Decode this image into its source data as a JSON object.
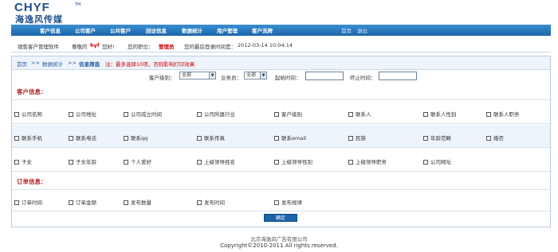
{
  "logo": {
    "en": "CHYF",
    "tm": "TM",
    "cn": "海逸风传媒"
  },
  "nav": {
    "items": [
      "客户信息",
      "公司客户",
      "公共客户",
      "回访信息",
      "数据统计",
      "用户管理",
      "客户洗牌"
    ],
    "right": [
      "首页",
      "退出"
    ]
  },
  "info": {
    "system": "销售客户管理软件",
    "greet_pre": "尊敬的",
    "user": "hyf",
    "greet_post": "您好!",
    "role_label": "您的职位：",
    "role": "管理员",
    "last_login_label": "您的最后登录时间是：",
    "last_login": "2012-03-14 10:04:14"
  },
  "crumb": {
    "home": "首页",
    "sep1": ">>",
    "stats": "数据统计",
    "sep2": ">>",
    "current": "信息筛选",
    "note": "注：最多选择10项，否则影响打印效果"
  },
  "filters": {
    "level_label": "客户级别：",
    "level_value": "全部",
    "staff_label": "业务员：",
    "staff_value": "全部",
    "start_label": "起始时间：",
    "end_label": "终止时间："
  },
  "customer_section": "客户信息：",
  "customer_rows": [
    [
      "公司名称",
      "公司地址",
      "公司成立时间",
      "公司所属行业",
      "客户级别",
      "联系人",
      "联系人性别",
      "联系人职务"
    ],
    [
      "联系手机",
      "联系电话",
      "联系qq",
      "联系传真",
      "联系email",
      "民族",
      "年龄范畴",
      "婚否"
    ],
    [
      "子女",
      "子女年龄",
      "个人爱好",
      "上级领导姓名",
      "上级领导性别",
      "上级领导职务",
      "公司网址"
    ]
  ],
  "order_section": "订单信息：",
  "order_row": [
    "订单时间",
    "订单金额",
    "发布数量",
    "发布时间",
    "发布规律"
  ],
  "ok_button": "确定",
  "footer": {
    "company": "北京海逸风广告有限公司",
    "copyright": "Copyright©2010-2011 All rights reserved."
  }
}
